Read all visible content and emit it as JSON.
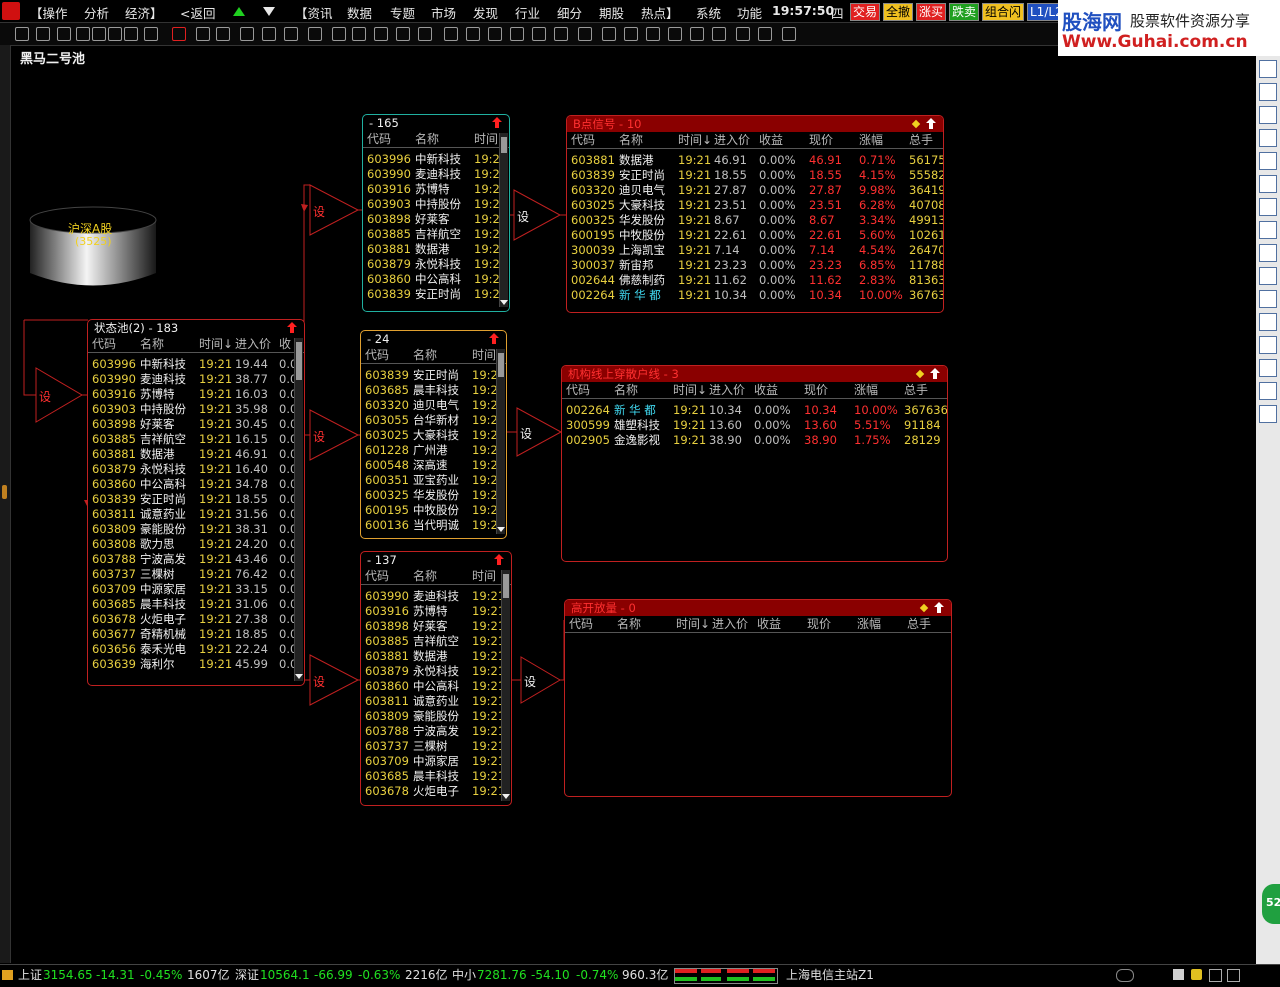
{
  "menubar": {
    "items": [
      "【操作",
      "分析",
      "经济】",
      "<返回",
      "【资讯",
      "数据",
      "专题",
      "市场",
      "发现",
      "行业",
      "细分",
      "期股",
      "热点】",
      "系统",
      "功能"
    ],
    "clock": "19:57:50",
    "weekday": "四",
    "trade_buttons": [
      "交易",
      "全撤",
      "涨买",
      "跌卖",
      "组合闪"
    ],
    "level_button": "L1/L2"
  },
  "brand": {
    "name": "股海网",
    "slogan": "股票软件资源分享",
    "url": "Www.Guhai.com.cn"
  },
  "page_title": "黑马二号池",
  "source_node": {
    "label": "沪深A股",
    "count": "(3525)"
  },
  "set_label": "设",
  "status_pool": {
    "title": "状态池(2) - 183",
    "columns": [
      "代码",
      "名称",
      "时间↓",
      "进入价",
      "收"
    ],
    "rows": [
      {
        "code": "603996",
        "name": "中新科技",
        "time": "19:21",
        "price": "19.44",
        "gain": "0.0"
      },
      {
        "code": "603990",
        "name": "麦迪科技",
        "time": "19:21",
        "price": "38.77",
        "gain": "0.0"
      },
      {
        "code": "603916",
        "name": "苏博特",
        "time": "19:21",
        "price": "16.03",
        "gain": "0.0"
      },
      {
        "code": "603903",
        "name": "中持股份",
        "time": "19:21",
        "price": "35.98",
        "gain": "0.0"
      },
      {
        "code": "603898",
        "name": "好莱客",
        "time": "19:21",
        "price": "30.45",
        "gain": "0.0"
      },
      {
        "code": "603885",
        "name": "吉祥航空",
        "time": "19:21",
        "price": "16.15",
        "gain": "0.0"
      },
      {
        "code": "603881",
        "name": "数据港",
        "time": "19:21",
        "price": "46.91",
        "gain": "0.0"
      },
      {
        "code": "603879",
        "name": "永悦科技",
        "time": "19:21",
        "price": "16.40",
        "gain": "0.0"
      },
      {
        "code": "603860",
        "name": "中公高科",
        "time": "19:21",
        "price": "34.78",
        "gain": "0.0"
      },
      {
        "code": "603839",
        "name": "安正时尚",
        "time": "19:21",
        "price": "18.55",
        "gain": "0.0"
      },
      {
        "code": "603811",
        "name": "诚意药业",
        "time": "19:21",
        "price": "31.56",
        "gain": "0.0"
      },
      {
        "code": "603809",
        "name": "豪能股份",
        "time": "19:21",
        "price": "38.31",
        "gain": "0.0"
      },
      {
        "code": "603808",
        "name": "歌力思",
        "time": "19:21",
        "price": "24.20",
        "gain": "0.0"
      },
      {
        "code": "603788",
        "name": "宁波高发",
        "time": "19:21",
        "price": "43.46",
        "gain": "0.0"
      },
      {
        "code": "603737",
        "name": "三棵树",
        "time": "19:21",
        "price": "76.42",
        "gain": "0.0"
      },
      {
        "code": "603709",
        "name": "中源家居",
        "time": "19:21",
        "price": "33.15",
        "gain": "0.0"
      },
      {
        "code": "603685",
        "name": "晨丰科技",
        "time": "19:21",
        "price": "31.06",
        "gain": "0.0"
      },
      {
        "code": "603678",
        "name": "火炬电子",
        "time": "19:21",
        "price": "27.38",
        "gain": "0.0"
      },
      {
        "code": "603677",
        "name": "奇精机械",
        "time": "19:21",
        "price": "18.85",
        "gain": "0.0"
      },
      {
        "code": "603656",
        "name": "泰禾光电",
        "time": "19:21",
        "price": "22.24",
        "gain": "0.0"
      },
      {
        "code": "603639",
        "name": "海利尔",
        "time": "19:21",
        "price": "45.99",
        "gain": "0.0"
      }
    ]
  },
  "pool_165": {
    "title": "- 165",
    "columns": [
      "代码",
      "名称",
      "时间"
    ],
    "rows": [
      {
        "code": "603996",
        "name": "中新科技",
        "time": "19:2"
      },
      {
        "code": "603990",
        "name": "麦迪科技",
        "time": "19:2"
      },
      {
        "code": "603916",
        "name": "苏博特",
        "time": "19:2"
      },
      {
        "code": "603903",
        "name": "中持股份",
        "time": "19:2"
      },
      {
        "code": "603898",
        "name": "好莱客",
        "time": "19:2"
      },
      {
        "code": "603885",
        "name": "吉祥航空",
        "time": "19:2"
      },
      {
        "code": "603881",
        "name": "数据港",
        "time": "19:2"
      },
      {
        "code": "603879",
        "name": "永悦科技",
        "time": "19:2"
      },
      {
        "code": "603860",
        "name": "中公高科",
        "time": "19:2"
      },
      {
        "code": "603839",
        "name": "安正时尚",
        "time": "19:2"
      }
    ]
  },
  "pool_24": {
    "title": "- 24",
    "columns": [
      "代码",
      "名称",
      "时间"
    ],
    "rows": [
      {
        "code": "603839",
        "name": "安正时尚",
        "time": "19:2"
      },
      {
        "code": "603685",
        "name": "晨丰科技",
        "time": "19:2"
      },
      {
        "code": "603320",
        "name": "迪贝电气",
        "time": "19:2"
      },
      {
        "code": "603055",
        "name": "台华新材",
        "time": "19:2"
      },
      {
        "code": "603025",
        "name": "大豪科技",
        "time": "19:2"
      },
      {
        "code": "601228",
        "name": "广州港",
        "time": "19:2"
      },
      {
        "code": "600548",
        "name": "深高速",
        "time": "19:2"
      },
      {
        "code": "600351",
        "name": "亚宝药业",
        "time": "19:2"
      },
      {
        "code": "600325",
        "name": "华发股份",
        "time": "19:2"
      },
      {
        "code": "600195",
        "name": "中牧股份",
        "time": "19:2"
      },
      {
        "code": "600136",
        "name": "当代明诚",
        "time": "19:2"
      }
    ]
  },
  "pool_137": {
    "title": "- 137",
    "columns": [
      "代码",
      "名称",
      "时间"
    ],
    "rows": [
      {
        "code": "603990",
        "name": "麦迪科技",
        "time": "19:21"
      },
      {
        "code": "603916",
        "name": "苏博特",
        "time": "19:21"
      },
      {
        "code": "603898",
        "name": "好莱客",
        "time": "19:21"
      },
      {
        "code": "603885",
        "name": "吉祥航空",
        "time": "19:21"
      },
      {
        "code": "603881",
        "name": "数据港",
        "time": "19:21"
      },
      {
        "code": "603879",
        "name": "永悦科技",
        "time": "19:21"
      },
      {
        "code": "603860",
        "name": "中公高科",
        "time": "19:21"
      },
      {
        "code": "603811",
        "name": "诚意药业",
        "time": "19:21"
      },
      {
        "code": "603809",
        "name": "豪能股份",
        "time": "19:21"
      },
      {
        "code": "603788",
        "name": "宁波高发",
        "time": "19:21"
      },
      {
        "code": "603737",
        "name": "三棵树",
        "time": "19:21"
      },
      {
        "code": "603709",
        "name": "中源家居",
        "time": "19:21"
      },
      {
        "code": "603685",
        "name": "晨丰科技",
        "time": "19:21"
      },
      {
        "code": "603678",
        "name": "火炬电子",
        "time": "19:21"
      }
    ]
  },
  "signal_b": {
    "title": "B点信号 - 10",
    "columns": [
      "代码",
      "名称",
      "时间↓",
      "进入价",
      "收益",
      "现价",
      "涨幅",
      "总手"
    ],
    "rows": [
      {
        "code": "603881",
        "name": "数据港",
        "time": "19:21",
        "entry": "46.91",
        "gain": "0.00%",
        "price": "46.91",
        "chg": "0.71%",
        "vol": "56175"
      },
      {
        "code": "603839",
        "name": "安正时尚",
        "time": "19:21",
        "entry": "18.55",
        "gain": "0.00%",
        "price": "18.55",
        "chg": "4.15%",
        "vol": "55582"
      },
      {
        "code": "603320",
        "name": "迪贝电气",
        "time": "19:21",
        "entry": "27.87",
        "gain": "0.00%",
        "price": "27.87",
        "chg": "9.98%",
        "vol": "36419"
      },
      {
        "code": "603025",
        "name": "大豪科技",
        "time": "19:21",
        "entry": "23.51",
        "gain": "0.00%",
        "price": "23.51",
        "chg": "6.28%",
        "vol": "40708"
      },
      {
        "code": "600325",
        "name": "华发股份",
        "time": "19:21",
        "entry": "8.67",
        "gain": "0.00%",
        "price": "8.67",
        "chg": "3.34%",
        "vol": "499134"
      },
      {
        "code": "600195",
        "name": "中牧股份",
        "time": "19:21",
        "entry": "22.61",
        "gain": "0.00%",
        "price": "22.61",
        "chg": "5.60%",
        "vol": "102619"
      },
      {
        "code": "300039",
        "name": "上海凯宝",
        "time": "19:21",
        "entry": "7.14",
        "gain": "0.00%",
        "price": "7.14",
        "chg": "4.54%",
        "vol": "264702"
      },
      {
        "code": "300037",
        "name": "新宙邦",
        "time": "19:21",
        "entry": "23.23",
        "gain": "0.00%",
        "price": "23.23",
        "chg": "6.85%",
        "vol": "117881"
      },
      {
        "code": "002644",
        "name": "佛慈制药",
        "time": "19:21",
        "entry": "11.62",
        "gain": "0.00%",
        "price": "11.62",
        "chg": "2.83%",
        "vol": "81363"
      },
      {
        "code": "002264",
        "name": "新 华 都",
        "time": "19:21",
        "entry": "10.34",
        "gain": "0.00%",
        "price": "10.34",
        "chg": "10.00%",
        "vol": "367636"
      }
    ]
  },
  "signal_inst": {
    "title": "机构线上穿散户线 - 3",
    "columns": [
      "代码",
      "名称",
      "时间↓",
      "进入价",
      "收益",
      "现价",
      "涨幅",
      "总手"
    ],
    "rows": [
      {
        "code": "002264",
        "name": "新 华 都",
        "time": "19:21",
        "entry": "10.34",
        "gain": "0.00%",
        "price": "10.34",
        "chg": "10.00%",
        "vol": "367636"
      },
      {
        "code": "300599",
        "name": "雄塑科技",
        "time": "19:21",
        "entry": "13.60",
        "gain": "0.00%",
        "price": "13.60",
        "chg": "5.51%",
        "vol": "91184"
      },
      {
        "code": "002905",
        "name": "金逸影视",
        "time": "19:21",
        "entry": "38.90",
        "gain": "0.00%",
        "price": "38.90",
        "chg": "1.75%",
        "vol": "28129"
      }
    ]
  },
  "signal_gap": {
    "title": "高开放量 - 0",
    "columns": [
      "代码",
      "名称",
      "时间↓",
      "进入价",
      "收益",
      "现价",
      "涨幅",
      "总手"
    ],
    "rows": []
  },
  "statusbar": {
    "sh_label": "上证",
    "sh_value": "3154.65",
    "sh_change": "-14.31",
    "sh_pct": "-0.45%",
    "sh_amount": "1607亿",
    "sz_label": "深证",
    "sz_value": "10564.1",
    "sz_change": "-66.99",
    "sz_pct": "-0.63%",
    "sz_amount": "2216亿",
    "zx_label": "中小",
    "zx_value": "7281.76",
    "zx_change": "-54.10",
    "zx_pct": "-0.74%",
    "zx_amount": "960.3亿",
    "server": "上海电信主站Z1"
  },
  "side_badge": "52",
  "colors": {
    "accent_red": "#c02020",
    "header_red": "#8a0000",
    "code_yellow": "#e8d040",
    "teal": "#20b0a0",
    "orange": "#e0a030"
  }
}
